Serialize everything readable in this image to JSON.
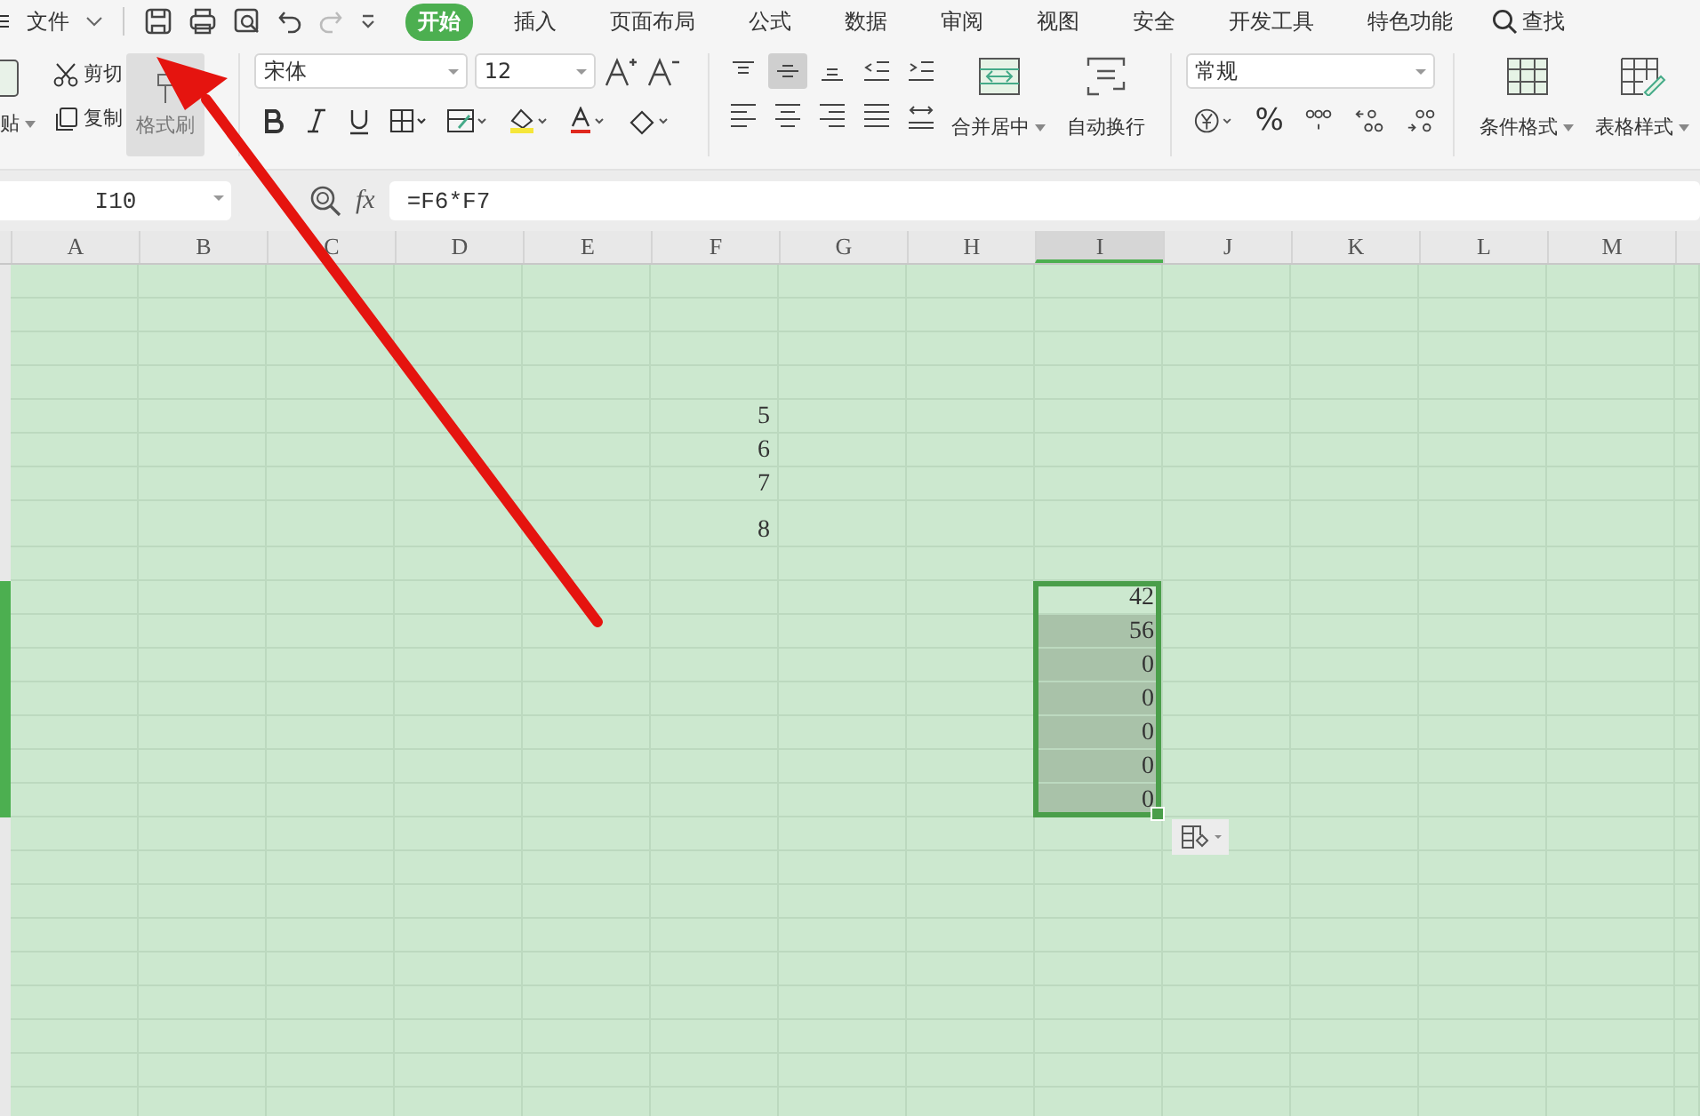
{
  "menu": {
    "file_label": "文件",
    "tabs": [
      {
        "label": "开始",
        "selected": true
      },
      {
        "label": "插入",
        "selected": false
      },
      {
        "label": "页面布局",
        "selected": false
      },
      {
        "label": "公式",
        "selected": false
      },
      {
        "label": "数据",
        "selected": false
      },
      {
        "label": "审阅",
        "selected": false
      },
      {
        "label": "视图",
        "selected": false
      },
      {
        "label": "安全",
        "selected": false
      },
      {
        "label": "开发工具",
        "selected": false
      },
      {
        "label": "特色功能",
        "selected": false
      }
    ],
    "search_label": "查找"
  },
  "ribbon": {
    "paste_label": "贴",
    "cut_label": "剪切",
    "copy_label": "复制",
    "format_painter": {
      "label": "格式刷",
      "pressed": true
    },
    "font_name": "宋体",
    "font_size": "12",
    "merge_label": "合并居中",
    "wrap_label": "自动换行",
    "number_format": "常规",
    "percent": "%",
    "conditional_format_label": "条件格式",
    "table_style_label": "表格样式"
  },
  "formula_bar": {
    "name_box": "I10",
    "fx": "fx",
    "formula": "=F6*F7"
  },
  "sheet": {
    "columns": [
      {
        "label": "A",
        "selected": false
      },
      {
        "label": "B",
        "selected": false
      },
      {
        "label": "C",
        "selected": false
      },
      {
        "label": "D",
        "selected": false
      },
      {
        "label": "E",
        "selected": false
      },
      {
        "label": "F",
        "selected": false
      },
      {
        "label": "G",
        "selected": false
      },
      {
        "label": "H",
        "selected": false
      },
      {
        "label": "I",
        "selected": true
      },
      {
        "label": "J",
        "selected": false
      },
      {
        "label": "K",
        "selected": false
      },
      {
        "label": "L",
        "selected": false
      },
      {
        "label": "M",
        "selected": false
      }
    ],
    "rows": [
      {
        "selected": false
      },
      {
        "selected": false
      },
      {
        "selected": false
      },
      {
        "selected": false
      },
      {
        "selected": false,
        "cells": [
          null,
          null,
          null,
          null,
          null,
          "5"
        ]
      },
      {
        "selected": false,
        "cells": [
          null,
          null,
          null,
          null,
          null,
          "6"
        ]
      },
      {
        "selected": false,
        "cells": [
          null,
          null,
          null,
          null,
          null,
          "7"
        ]
      },
      {
        "selected": false,
        "cells": [
          null,
          null,
          null,
          null,
          null,
          "8"
        ]
      },
      {
        "selected": false
      },
      {
        "selected": true,
        "cells": [
          null,
          null,
          null,
          null,
          null,
          null,
          null,
          null,
          "42"
        ]
      },
      {
        "selected": true,
        "cells": [
          null,
          null,
          null,
          null,
          null,
          null,
          null,
          null,
          "56"
        ]
      },
      {
        "selected": true,
        "cells": [
          null,
          null,
          null,
          null,
          null,
          null,
          null,
          null,
          "0"
        ]
      },
      {
        "selected": true,
        "cells": [
          null,
          null,
          null,
          null,
          null,
          null,
          null,
          null,
          "0"
        ]
      },
      {
        "selected": true,
        "cells": [
          null,
          null,
          null,
          null,
          null,
          null,
          null,
          null,
          "0"
        ]
      },
      {
        "selected": true,
        "cells": [
          null,
          null,
          null,
          null,
          null,
          null,
          null,
          null,
          "0"
        ]
      },
      {
        "selected": true,
        "cells": [
          null,
          null,
          null,
          null,
          null,
          null,
          null,
          null,
          "0"
        ]
      },
      {
        "selected": false
      },
      {
        "selected": false
      },
      {
        "selected": false
      },
      {
        "selected": false
      },
      {
        "selected": false
      },
      {
        "selected": false
      },
      {
        "selected": false
      },
      {
        "selected": false
      },
      {
        "selected": false
      }
    ]
  }
}
